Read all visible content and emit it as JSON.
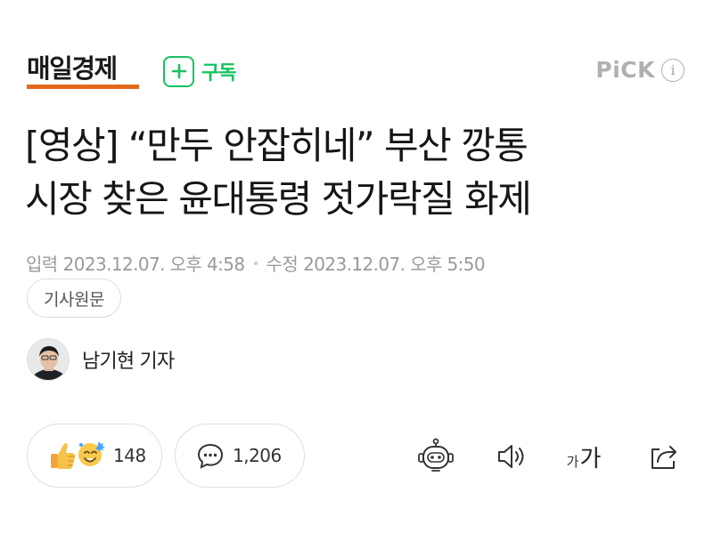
{
  "header": {
    "logo_text": "매일경제",
    "logo_accent": "#e3691a",
    "subscribe_label": "구독",
    "subscribe_icon": "plus-icon",
    "subscribe_color": "#16c35f",
    "pick_label": "PiCK",
    "pick_info": "i"
  },
  "article": {
    "headline_line1": "[영상] “만두 안잡히네” 부산 깡통",
    "headline_line2": "시장 찾은 윤대통령 젓가락질 화제",
    "input_label": "입력",
    "input_time": "2023.12.07. 오후 4:58",
    "edit_label": "수정",
    "edit_time": "2023.12.07. 오후 5:50",
    "original_button": "기사원문"
  },
  "reporter": {
    "name": "남기현 기자"
  },
  "reactions": {
    "like_count": "148",
    "comment_count": "1,206"
  },
  "tools": {
    "font_small": "가",
    "font_big": "가",
    "icons": [
      "robot-summary-icon",
      "speaker-icon",
      "font-size-icon",
      "share-icon"
    ]
  }
}
